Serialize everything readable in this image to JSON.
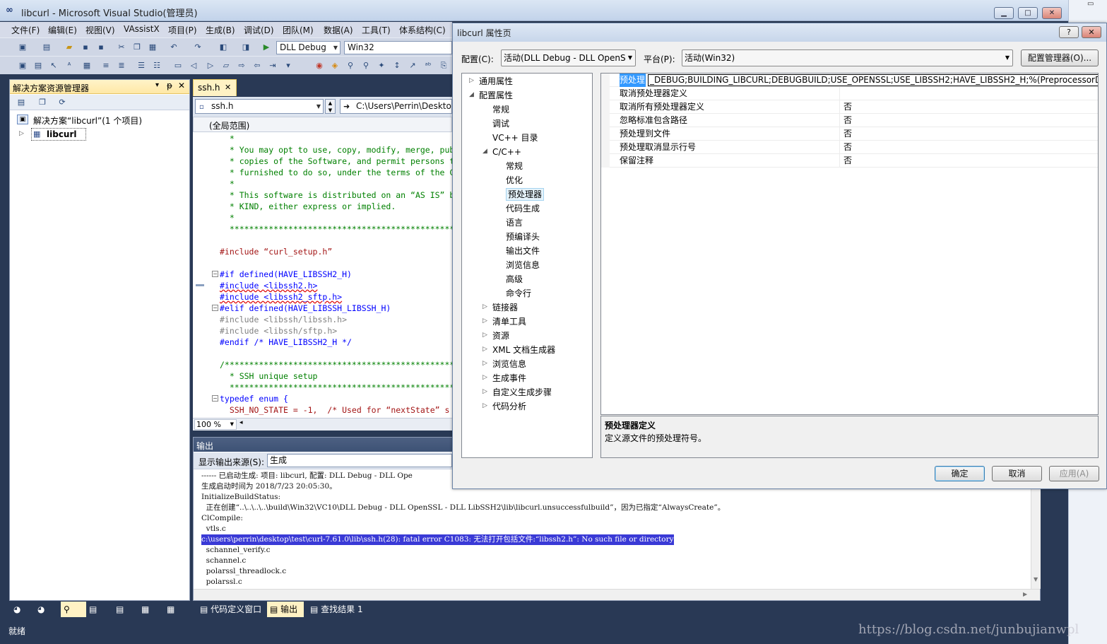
{
  "window": {
    "title": "libcurl - Microsoft Visual Studio(管理员)",
    "caption_buttons": [
      "▁",
      "□",
      "✕"
    ]
  },
  "menu": [
    "文件(F)",
    "编辑(E)",
    "视图(V)",
    "VAssistX",
    "项目(P)",
    "生成(B)",
    "调试(D)",
    "团队(M)",
    "数据(A)",
    "工具(T)",
    "体系结构(C)"
  ],
  "toolbar": {
    "config_value": "DLL Debug",
    "platform_value": "Win32"
  },
  "solution_explorer": {
    "title": "解决方案资源管理器",
    "header_buttons": [
      "▾",
      "ᵽ",
      "✕"
    ],
    "solution_label": "解决方案“libcurl”(1 个项目)",
    "project_label": "libcurl"
  },
  "editor": {
    "tab_label": "ssh.h",
    "tab_close": "✕",
    "file_combo": "ssh.h",
    "path_combo": "C:\\Users\\Perrin\\Deskto",
    "scope": "(全局范围)",
    "zoom": "100 %",
    "lines": [
      {
        "text": "  *",
        "cls": "cm"
      },
      {
        "text": "  * You may opt to use, copy, modify, merge, pub",
        "cls": "cm"
      },
      {
        "text": "  * copies of the Software, and permit persons t",
        "cls": "cm"
      },
      {
        "text": "  * furnished to do so, under the terms of the C",
        "cls": "cm"
      },
      {
        "text": "  *",
        "cls": "cm"
      },
      {
        "text": "  * This software is distributed on an “AS IS” b",
        "cls": "cm"
      },
      {
        "text": "  * KIND, either express or implied.",
        "cls": "cm"
      },
      {
        "text": "  *",
        "cls": "cm"
      },
      {
        "text": "  ***********************************************",
        "cls": "cm"
      },
      {
        "text": "",
        "cls": ""
      },
      {
        "text": "#include “curl_setup.h”",
        "cls": "pp-str"
      },
      {
        "text": "",
        "cls": ""
      },
      {
        "text": "#if defined(HAVE_LIBSSH2_H)",
        "cls": "pp-if"
      },
      {
        "text": "#include <libssh2.h>",
        "cls": "pp-inc"
      },
      {
        "text": "#include <libssh2_sftp.h>",
        "cls": "pp-inc"
      },
      {
        "text": "#elif defined(HAVE_LIBSSH_LIBSSH_H)",
        "cls": "pp-if"
      },
      {
        "text": "#include <libssh/libssh.h>",
        "cls": "gr-inc"
      },
      {
        "text": "#include <libssh/sftp.h>",
        "cls": "gr-inc"
      },
      {
        "text": "#endif /* HAVE_LIBSSH2_H */",
        "cls": "pp-end"
      },
      {
        "text": "",
        "cls": ""
      },
      {
        "text": "/************************************************",
        "cls": "cm"
      },
      {
        "text": "  * SSH unique setup",
        "cls": "cm"
      },
      {
        "text": "  ***********************************************",
        "cls": "cm"
      },
      {
        "text": "typedef enum {",
        "cls": "kw"
      },
      {
        "text": "  SSH_NO_STATE = -1,  /* Used for “nextState” s",
        "cls": "enum"
      }
    ]
  },
  "output": {
    "title": "输出",
    "source_label": "显示输出来源(S):",
    "source_value": "生成",
    "lines": [
      "------ 已启动生成: 项目: libcurl, 配置: DLL Debug - DLL Ope",
      "生成启动时间为 2018/7/23 20:05:30。",
      "InitializeBuildStatus:",
      "  正在创建“..\\..\\..\\..\\build\\Win32\\VC10\\DLL Debug - DLL OpenSSL - DLL LibSSH2\\lib\\libcurl.unsuccessfulbuild”，因为已指定“AlwaysCreate”。",
      "ClCompile:",
      "  vtls.c",
      "c:\\users\\perrin\\desktop\\test\\curl-7.61.0\\lib\\ssh.h(28): fatal error C1083: 无法打开包括文件:“libssh2.h”: No such file or directory",
      "  schannel_verify.c",
      "  schannel.c",
      "  polarssl_threadlock.c",
      "  polarssl.c"
    ],
    "highlight_index": 6
  },
  "bottom_tabs": {
    "def_window": "代码定义窗口",
    "output": "输出",
    "find_results": "查找结果 1"
  },
  "status": "就绪",
  "dialog": {
    "title": "libcurl 属性页",
    "help_btn": "?",
    "close_btn": "✕",
    "config_label": "配置(C):",
    "config_value": "活动(DLL Debug - DLL OpenS",
    "platform_label": "平台(P):",
    "platform_value": "活动(Win32)",
    "config_manager": "配置管理器(O)...",
    "tree": [
      {
        "label": "通用属性",
        "level": 0,
        "arrow": "▷"
      },
      {
        "label": "配置属性",
        "level": 0,
        "arrow": "◢"
      },
      {
        "label": "常规",
        "level": 1,
        "arrow": ""
      },
      {
        "label": "调试",
        "level": 1,
        "arrow": ""
      },
      {
        "label": "VC++ 目录",
        "level": 1,
        "arrow": ""
      },
      {
        "label": "C/C++",
        "level": 1,
        "arrow": "◢"
      },
      {
        "label": "常规",
        "level": 2,
        "arrow": ""
      },
      {
        "label": "优化",
        "level": 2,
        "arrow": ""
      },
      {
        "label": "预处理器",
        "level": 2,
        "arrow": "",
        "selected": true
      },
      {
        "label": "代码生成",
        "level": 2,
        "arrow": ""
      },
      {
        "label": "语言",
        "level": 2,
        "arrow": ""
      },
      {
        "label": "预编译头",
        "level": 2,
        "arrow": ""
      },
      {
        "label": "输出文件",
        "level": 2,
        "arrow": ""
      },
      {
        "label": "浏览信息",
        "level": 2,
        "arrow": ""
      },
      {
        "label": "高级",
        "level": 2,
        "arrow": ""
      },
      {
        "label": "命令行",
        "level": 2,
        "arrow": ""
      },
      {
        "label": "链接器",
        "level": 1,
        "arrow": "▷"
      },
      {
        "label": "清单工具",
        "level": 1,
        "arrow": "▷"
      },
      {
        "label": "资源",
        "level": 1,
        "arrow": "▷"
      },
      {
        "label": "XML 文档生成器",
        "level": 1,
        "arrow": "▷"
      },
      {
        "label": "浏览信息",
        "level": 1,
        "arrow": "▷"
      },
      {
        "label": "生成事件",
        "level": 1,
        "arrow": "▷"
      },
      {
        "label": "自定义生成步骤",
        "level": 1,
        "arrow": "▷"
      },
      {
        "label": "代码分析",
        "level": 1,
        "arrow": "▷"
      }
    ],
    "props": [
      {
        "name": "预处理",
        "value": "_DEBUG;BUILDING_LIBCURL;DEBUGBUILD;USE_OPENSSL;USE_LIBSSH2;HAVE_LIBSSH2_H;%(PreprocessorDefiniti",
        "selected": true
      },
      {
        "name": "取消预处理器定义",
        "value": ""
      },
      {
        "name": "取消所有预处理器定义",
        "value": "否"
      },
      {
        "name": "忽略标准包含路径",
        "value": "否"
      },
      {
        "name": "预处理到文件",
        "value": "否"
      },
      {
        "name": "预处理取消显示行号",
        "value": "否"
      },
      {
        "name": "保留注释",
        "value": "否"
      }
    ],
    "desc_title": "预处理器定义",
    "desc_text": "定义源文件的预处理符号。",
    "ok": "确定",
    "cancel": "取消",
    "apply": "应用(A)"
  },
  "watermark": "https://blog.csdn.net/junbujianwpl"
}
